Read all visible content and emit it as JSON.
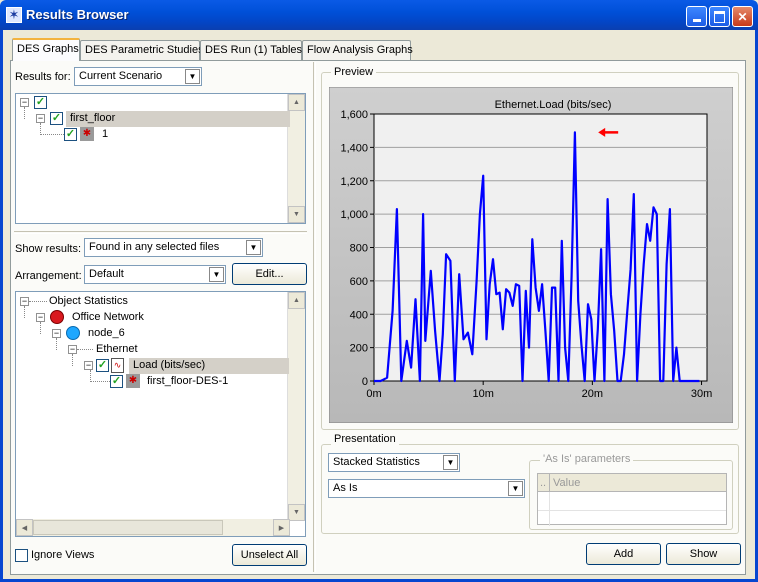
{
  "window": {
    "title": "Results Browser"
  },
  "tabs": [
    {
      "label": "DES Graphs",
      "active": true
    },
    {
      "label": "DES Parametric Studies",
      "active": false
    },
    {
      "label": "DES Run (1) Tables",
      "active": false
    },
    {
      "label": "Flow Analysis Graphs",
      "active": false
    }
  ],
  "results_for": {
    "label": "Results for:",
    "value": "Current Scenario"
  },
  "results_tree": [
    {
      "label": "first_floor"
    },
    {
      "label": "1"
    }
  ],
  "show_results": {
    "label": "Show results:",
    "value": "Found in any selected files"
  },
  "arrangement": {
    "label": "Arrangement:",
    "value": "Default",
    "edit_label": "Edit..."
  },
  "stats_tree": [
    {
      "label": "Object Statistics"
    },
    {
      "label": "Office Network"
    },
    {
      "label": "node_6"
    },
    {
      "label": "Ethernet"
    },
    {
      "label": "Load (bits/sec)"
    },
    {
      "label": "first_floor-DES-1"
    }
  ],
  "ignore_views": {
    "label": "Ignore Views",
    "checked": false
  },
  "unselect_all_label": "Unselect All",
  "preview": {
    "title": "Preview"
  },
  "presentation": {
    "title": "Presentation",
    "mode": "Stacked Statistics",
    "filter": "As Is",
    "params_title": "'As Is' parameters",
    "params_col_value": "Value",
    "params_col_dot": ".."
  },
  "add_label": "Add",
  "show_label": "Show",
  "colors": {
    "series": "#0000ff",
    "plot_bg": "#f0f0f0",
    "frame_bg": "#c0c0c0",
    "marker": "#ff0000",
    "accent_tab": "#f3b33f"
  },
  "chart_data": {
    "type": "line",
    "title": "Ethernet.Load (bits/sec)",
    "xlabel": "",
    "ylabel": "",
    "x_ticks": [
      "0m",
      "10m",
      "20m",
      "30m"
    ],
    "y_ticks": [
      "0",
      "200",
      "400",
      "600",
      "800",
      "1,000",
      "1,200",
      "1,400",
      "1,600"
    ],
    "xlim": [
      0,
      30.5
    ],
    "ylim": [
      0,
      1600
    ],
    "grid": true,
    "series": [
      {
        "x": [
          0,
          0.6,
          1.2,
          1.7,
          2.1,
          2.5,
          3.0,
          3.4,
          3.8,
          4.2,
          4.5,
          4.7,
          5.2,
          5.6,
          6.0,
          6.3,
          6.6,
          7.0,
          7.4,
          7.8,
          8.2,
          8.6,
          9.0,
          9.4,
          9.7,
          10.0,
          10.3,
          10.6,
          10.9,
          11.2,
          11.5,
          11.8,
          12.1,
          12.4,
          12.7,
          13.0,
          13.3,
          13.6,
          13.9,
          14.2,
          14.5,
          14.8,
          15.1,
          15.4,
          15.7,
          16.0,
          16.3,
          16.6,
          16.9,
          17.2,
          17.5,
          17.8,
          18.1,
          18.4,
          18.7,
          19.0,
          19.3,
          19.6,
          19.9,
          20.2,
          20.5,
          20.8,
          21.1,
          21.4,
          21.7,
          22.0,
          22.3,
          22.6,
          22.9,
          23.2,
          23.5,
          23.8,
          24.1,
          24.4,
          24.7,
          25.0,
          25.3,
          25.6,
          25.9,
          26.2,
          26.5,
          26.8,
          27.1,
          27.4,
          27.7,
          28.0,
          28.3,
          28.6,
          28.9,
          29.2,
          29.5,
          29.8
        ],
        "y": [
          0,
          0,
          20,
          420,
          1030,
          0,
          240,
          80,
          490,
          0,
          1000,
          240,
          660,
          300,
          0,
          280,
          760,
          720,
          0,
          640,
          250,
          290,
          160,
          600,
          1000,
          1230,
          250,
          580,
          730,
          520,
          530,
          310,
          550,
          530,
          450,
          580,
          570,
          0,
          540,
          200,
          850,
          560,
          420,
          580,
          300,
          0,
          560,
          560,
          0,
          840,
          200,
          0,
          630,
          1490,
          480,
          220,
          0,
          460,
          370,
          0,
          310,
          790,
          0,
          1090,
          520,
          300,
          0,
          0,
          160,
          420,
          670,
          1120,
          0,
          400,
          700,
          940,
          840,
          1040,
          1000,
          0,
          0,
          700,
          1030,
          0,
          200,
          0,
          0,
          0,
          0,
          0,
          0,
          0
        ]
      }
    ],
    "peak_marker": {
      "x": 19.8,
      "y": 1490
    }
  }
}
